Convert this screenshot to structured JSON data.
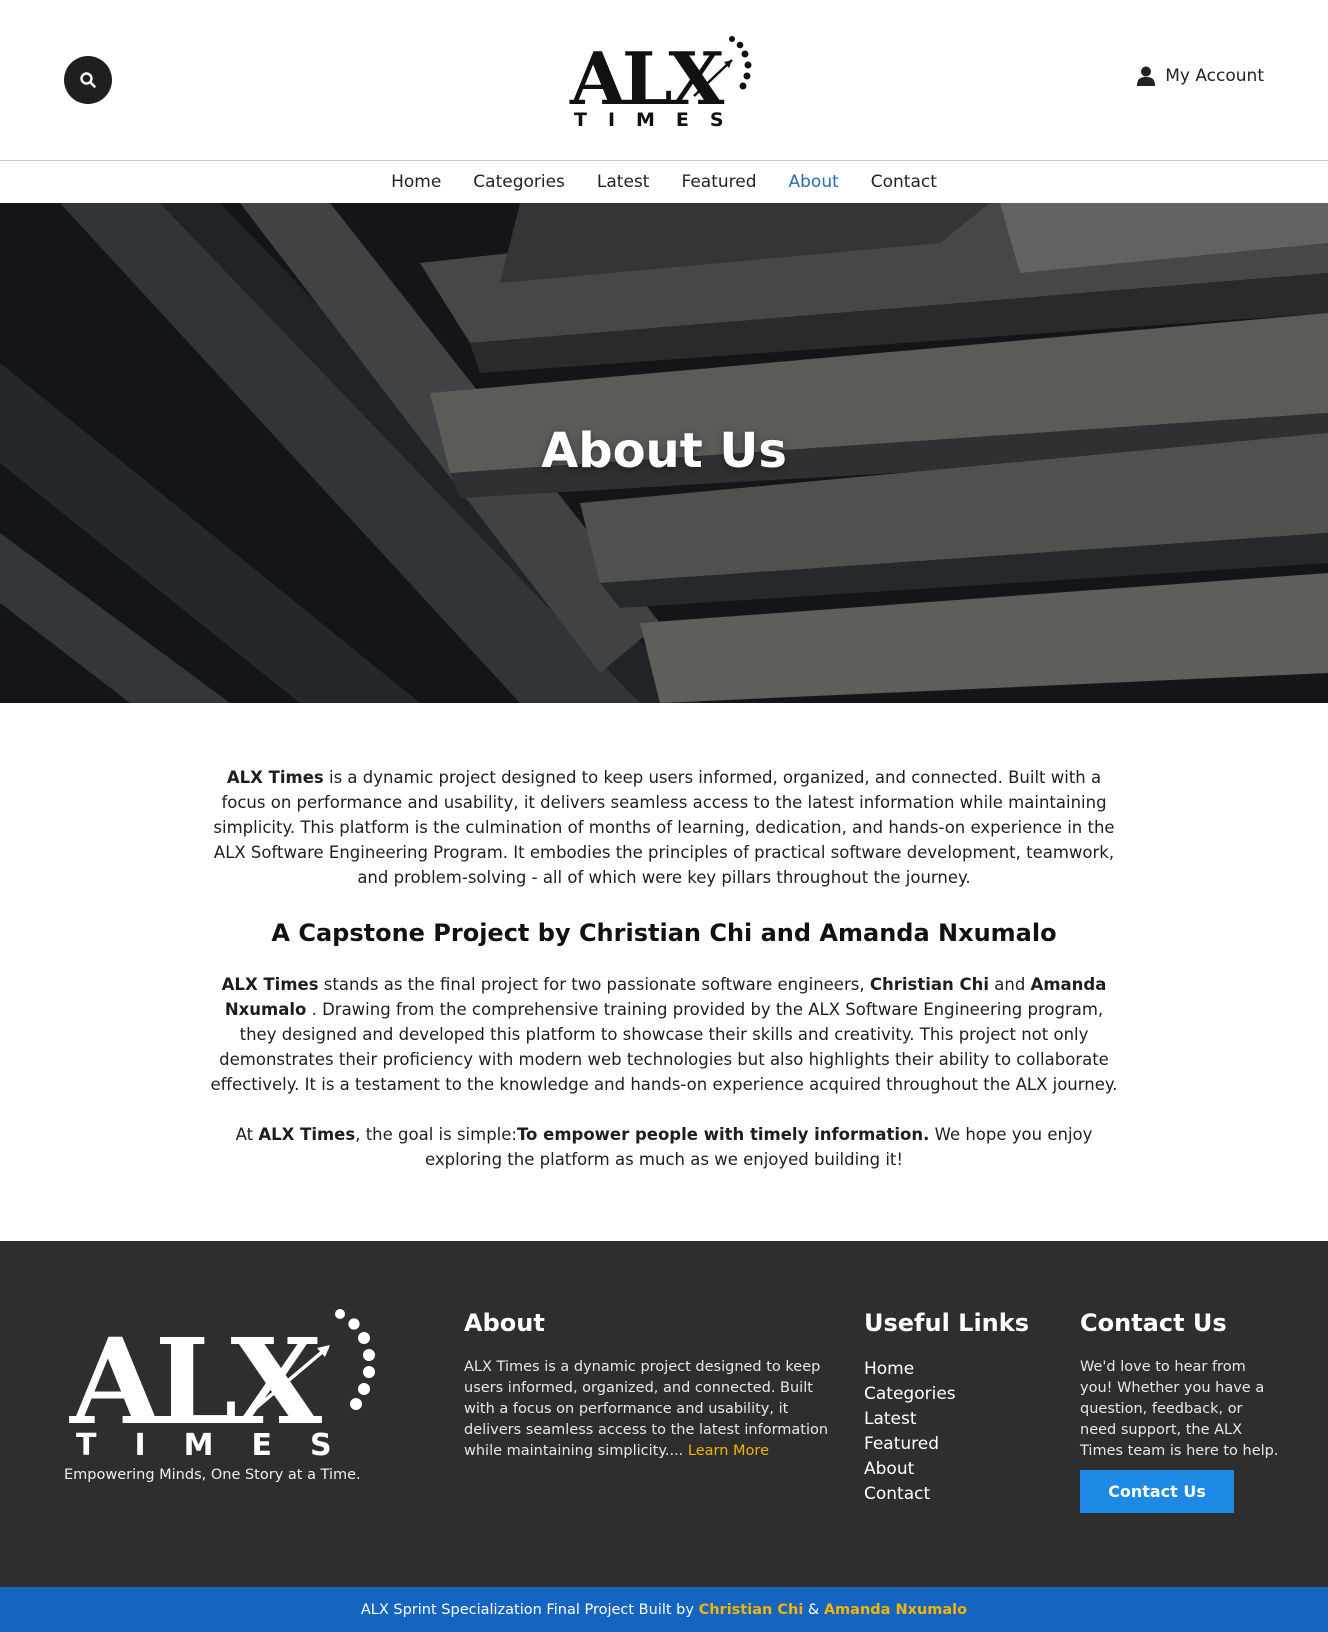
{
  "header": {
    "logo_text": "ALX",
    "logo_sub": "TIMES",
    "account_label": "My Account"
  },
  "nav": {
    "items": [
      {
        "label": "Home"
      },
      {
        "label": "Categories"
      },
      {
        "label": "Latest"
      },
      {
        "label": "Featured"
      },
      {
        "label": "About",
        "active": true
      },
      {
        "label": "Contact"
      }
    ]
  },
  "hero": {
    "title": "About Us"
  },
  "content": {
    "p1_strong": "ALX Times",
    "p1_text": " is a dynamic project designed to keep users informed, organized, and connected. Built with a focus on performance and usability, it delivers seamless access to the latest information while maintaining simplicity. This platform is the culmination of months of learning, dedication, and hands-on experience in the ALX Software Engineering Program. It embodies the principles of practical software development, teamwork, and problem-solving - all of which were key pillars throughout the journey.",
    "heading": "A Capstone Project by Christian Chi and Amanda Nxumalo",
    "p2_strong1": "ALX Times",
    "p2_text1": " stands as the final project for two passionate software engineers, ",
    "p2_strong2": "Christian Chi",
    "p2_text2": " and ",
    "p2_strong3": "Amanda Nxumalo",
    "p2_text3": " . Drawing from the comprehensive training provided by the ALX Software Engineering program, they designed and developed this platform to showcase their skills and creativity. This project not only demonstrates their proficiency with modern web technologies but also highlights their ability to collaborate effectively. It is a testament to the knowledge and hands-on experience acquired throughout the ALX journey.",
    "p3_text1": "At ",
    "p3_strong1": "ALX Times",
    "p3_text2": ", the goal is simple:",
    "p3_strong2": "To empower people with timely information.",
    "p3_text3": " We hope you enjoy exploring the platform as much as we enjoyed building it!"
  },
  "footer": {
    "tagline": "Empowering Minds, One Story at a Time.",
    "about_title": "About",
    "about_text": "ALX Times is a dynamic project designed to keep users informed, organized, and connected. Built with a focus on performance and usability, it delivers seamless access to the latest information while maintaining simplicity....",
    "learn_more": "Learn More",
    "links_title": "Useful Links",
    "links": [
      "Home",
      "Categories",
      "Latest",
      "Featured",
      "About",
      "Contact"
    ],
    "contact_title": "Contact Us",
    "contact_text": "We'd love to hear from you! Whether you have a question, feedback, or need support, the ALX Times team is here to help.",
    "contact_button": "Contact Us"
  },
  "bottom_bar": {
    "prefix": "ALX Sprint Specialization Final Project Built by ",
    "name1": "Christian Chi",
    "amp": " & ",
    "name2": "Amanda Nxumalo"
  },
  "colors": {
    "nav_active": "#2a6bb5",
    "footer_bg": "#2e2e2e",
    "accent_yellow": "#f5b400",
    "button_blue": "#1e88e5",
    "bottom_bar": "#1565c0"
  }
}
